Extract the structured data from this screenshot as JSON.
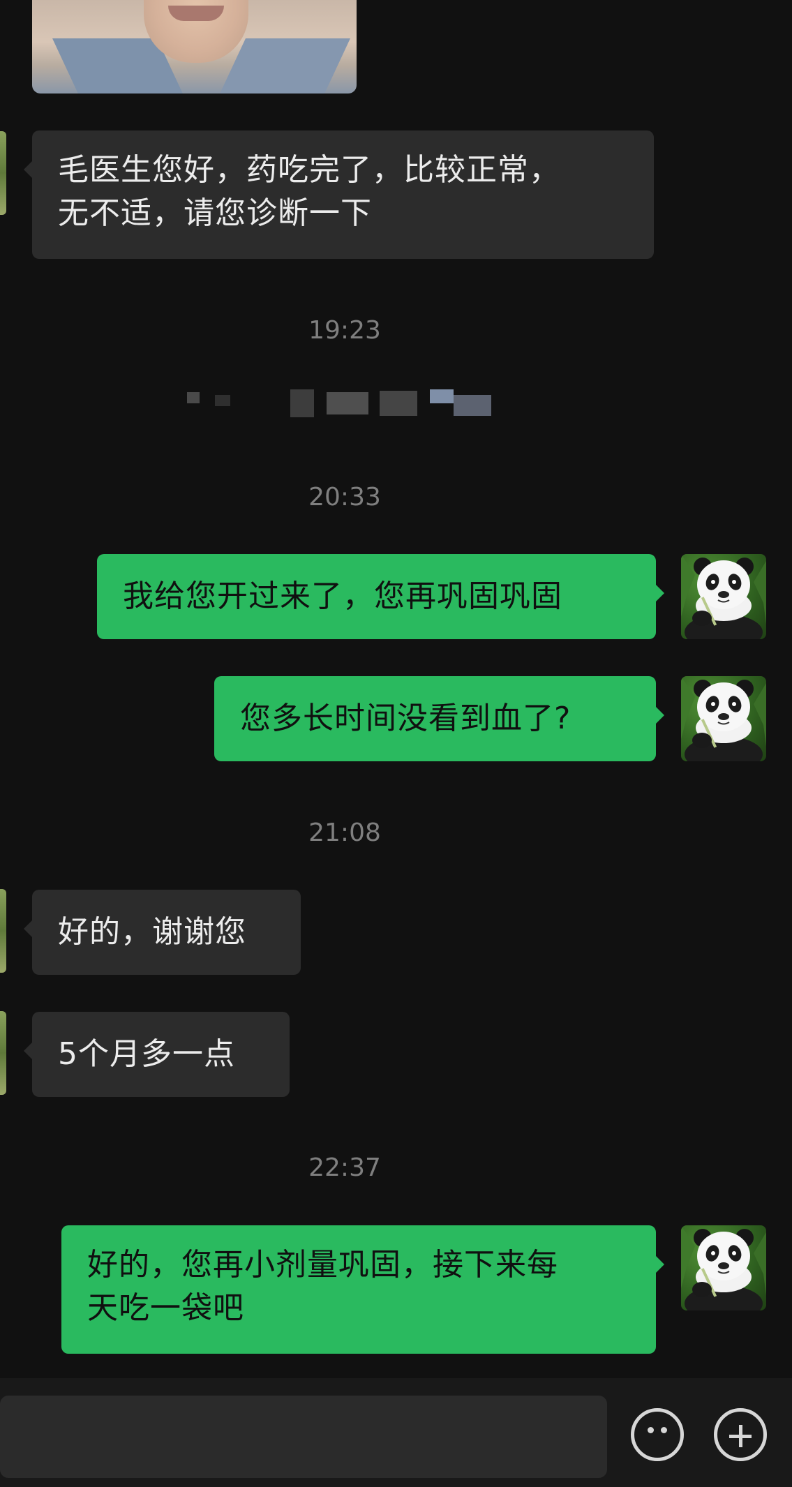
{
  "messages": {
    "m1": "毛医生您好，药吃完了，比较正常，\n无不适，请您诊断一下",
    "m2": "我给您开过来了，您再巩固巩固",
    "m3": "您多长时间没看到血了?",
    "m4": "好的，谢谢您",
    "m5": "5个月多一点",
    "m6": "好的，您再小剂量巩固，接下来每\n天吃一袋吧"
  },
  "times": {
    "t1": "19:23",
    "t2": "20:33",
    "t3": "21:08",
    "t4": "22:37"
  },
  "icons": {
    "emoji": "emoji-icon",
    "add": "plus-circle-icon"
  },
  "colors": {
    "background": "#111111",
    "incoming_bubble": "#2c2c2c",
    "outgoing_bubble": "#2aba5f",
    "timestamp": "#7f7f7f"
  }
}
